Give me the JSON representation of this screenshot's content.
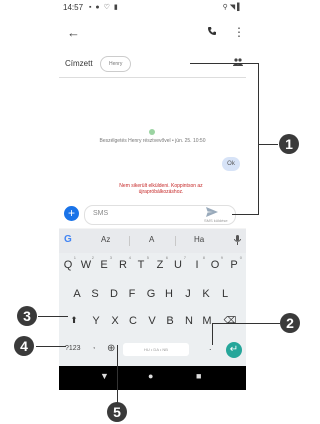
{
  "status": {
    "time": "14:57",
    "left_icons": "▪ ● ♡ ▮",
    "right_icons": "⚲ ◥ ▌"
  },
  "header": {
    "back": "←",
    "more": "⋮"
  },
  "recipient": {
    "label": "Címzett",
    "chip": "Henry"
  },
  "thread": {
    "info": "Beszélgetés Henry résztvevővel • jún. 25. 10:50",
    "bubble": "Ok",
    "error": "Nem sikerült elküldeni. Koppintson az újrapróbálkozáshoz."
  },
  "composer": {
    "plus": "+",
    "placeholder": "SMS",
    "send_label": "SMS küldése"
  },
  "keyboard": {
    "g": "G",
    "suggestions": [
      "Az",
      "A",
      "Ha"
    ],
    "row1": [
      "Q",
      "W",
      "E",
      "R",
      "T",
      "Z",
      "U",
      "I",
      "O",
      "P"
    ],
    "row1_hints": [
      "1",
      "2",
      "3",
      "4",
      "5",
      "6",
      "7",
      "8",
      "9",
      "0"
    ],
    "row2": [
      "A",
      "S",
      "D",
      "F",
      "G",
      "H",
      "J",
      "K",
      "L"
    ],
    "row3": [
      "Y",
      "X",
      "C",
      "V",
      "B",
      "N",
      "M"
    ],
    "shift": "⬆",
    "backspace": "⌫",
    "sym": "?123",
    "comma": ",",
    "globe": "⊕",
    "space": "HU • DA • NB",
    "period": ".",
    "enter": "↵"
  },
  "nav": {
    "back": "▼",
    "home": "●",
    "recents": "■"
  },
  "callouts": [
    "1",
    "2",
    "3",
    "4",
    "5"
  ]
}
